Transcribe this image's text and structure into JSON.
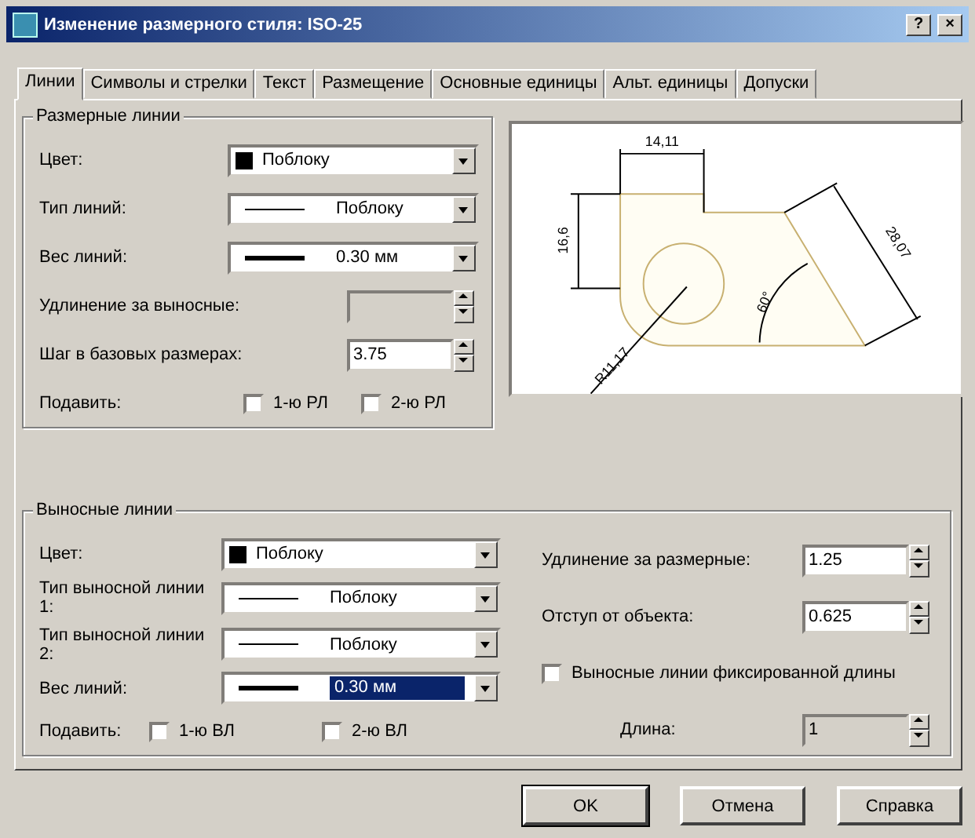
{
  "window": {
    "title": "Изменение размерного стиля: ISO-25",
    "help_button": "?",
    "close_button": "×"
  },
  "tabs": [
    {
      "label": "Линии",
      "selected": true
    },
    {
      "label": "Символы и стрелки",
      "selected": false
    },
    {
      "label": "Текст",
      "selected": false
    },
    {
      "label": "Размещение",
      "selected": false
    },
    {
      "label": "Основные единицы",
      "selected": false
    },
    {
      "label": "Альт. единицы",
      "selected": false
    },
    {
      "label": "Допуски",
      "selected": false
    }
  ],
  "dimension_lines": {
    "title": "Размерные линии",
    "fields": [
      {
        "kind": "color",
        "label": "Цвет:",
        "value": "Поблоку",
        "color": "#000000"
      },
      {
        "kind": "linetype",
        "label": "Тип линий:",
        "value": "Поблоку"
      },
      {
        "kind": "lineweight",
        "label": "Вес линий:",
        "value": "0.30 мм"
      },
      {
        "kind": "spin",
        "label": "Удлинение за выносные:",
        "disabled": true
      },
      {
        "kind": "spin",
        "label": "Шаг в базовых размерах:",
        "value": "3.75",
        "disabled": false
      },
      {
        "kind": "suppress",
        "label": "Подавить:",
        "options": [
          {
            "label": "1-ю РЛ",
            "checked": false
          },
          {
            "label": "2-ю РЛ",
            "checked": false
          }
        ]
      }
    ]
  },
  "preview": {
    "labels": [
      "14,11",
      "16,6",
      "28,07",
      "60°",
      "R11,17"
    ]
  },
  "extension_lines": {
    "title": "Выносные линии",
    "fields": [
      {
        "kind": "color",
        "label": "Цвет:",
        "value": "Поблоку",
        "color": "#000000",
        "highlighted": false
      },
      {
        "kind": "linetype",
        "label": "Тип выносной линии 1:",
        "value": "Поблоку",
        "highlighted": false
      },
      {
        "kind": "linetype",
        "label": "Тип выносной линии 2:",
        "value": "Поблоку",
        "highlighted": false
      },
      {
        "kind": "lineweight",
        "label": "Вес линий:",
        "value": "0.30 мм",
        "highlighted": true
      },
      {
        "kind": "suppress",
        "label": "Подавить:",
        "options": [
          {
            "label": "1-ю ВЛ",
            "checked": false
          },
          {
            "label": "2-ю ВЛ",
            "checked": false
          }
        ]
      }
    ],
    "right_fields": [
      {
        "kind": "spin",
        "label": "Удлинение за размерные:",
        "value": "1.25",
        "disabled": false
      },
      {
        "kind": "spin",
        "label": "Отступ от объекта:",
        "value": "0.625",
        "disabled": false
      },
      {
        "kind": "check",
        "label": "Выносные линии фиксированной длины",
        "checked": false
      },
      {
        "kind": "spin",
        "label": "Длина:",
        "value": "1",
        "disabled": true
      }
    ]
  },
  "buttons": [
    {
      "label": "OK",
      "default": true
    },
    {
      "label": "Отмена",
      "default": false
    },
    {
      "label": "Справка",
      "default": false
    }
  ]
}
